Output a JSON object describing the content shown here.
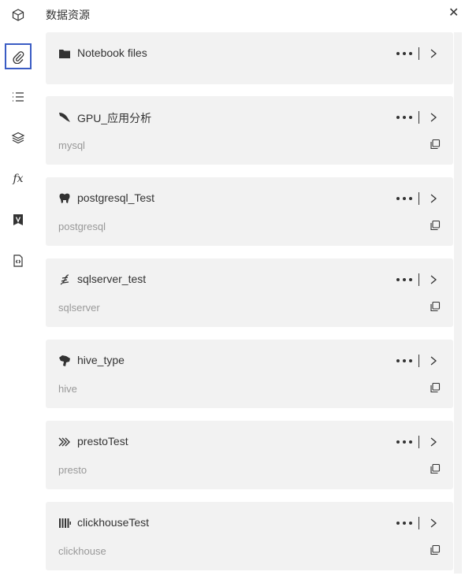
{
  "header": {
    "title": "数据资源",
    "close_icon": "close-icon"
  },
  "rail": {
    "items": [
      {
        "name": "box-icon"
      },
      {
        "name": "paperclip-icon",
        "active": true
      },
      {
        "name": "list-icon"
      },
      {
        "name": "layers-icon"
      },
      {
        "name": "function-icon",
        "label": "fx"
      },
      {
        "name": "variable-icon"
      },
      {
        "name": "code-file-icon"
      }
    ],
    "accent": "#3a5cc4"
  },
  "resources": [
    {
      "name": "Notebook files",
      "type": "",
      "icon": "folder-icon"
    },
    {
      "name": "GPU_应用分析",
      "type": "mysql",
      "icon": "mysql-icon"
    },
    {
      "name": "postgresql_Test",
      "type": "postgresql",
      "icon": "postgresql-icon"
    },
    {
      "name": "sqlserver_test",
      "type": "sqlserver",
      "icon": "sqlserver-icon"
    },
    {
      "name": "hive_type",
      "type": "hive",
      "icon": "hive-icon"
    },
    {
      "name": "prestoTest",
      "type": "presto",
      "icon": "presto-icon"
    },
    {
      "name": "clickhouseTest",
      "type": "clickhouse",
      "icon": "clickhouse-icon"
    }
  ]
}
